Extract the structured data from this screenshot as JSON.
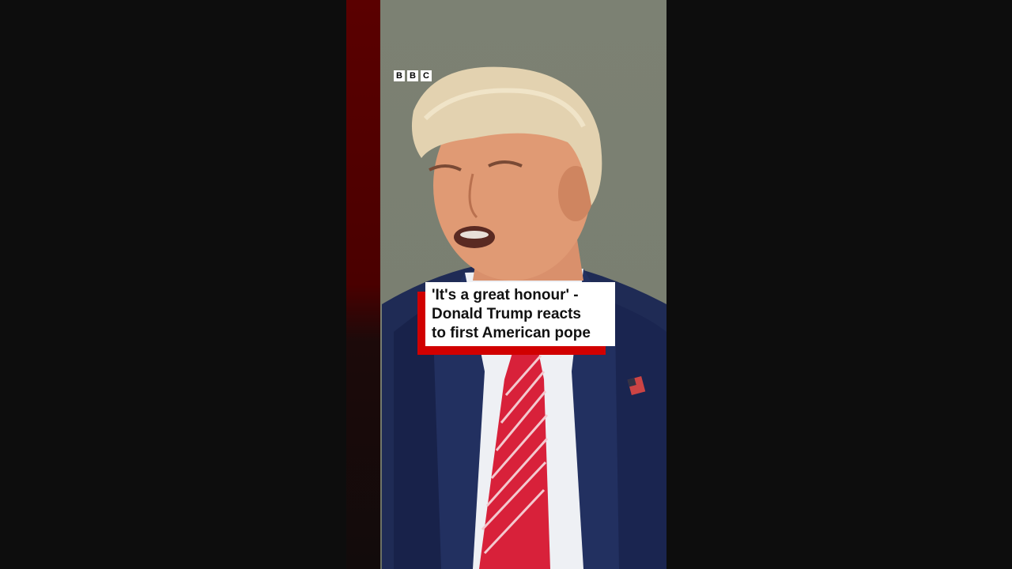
{
  "player": {
    "brand": {
      "letters": [
        "B",
        "B",
        "C"
      ]
    },
    "caption": {
      "line1": "'It's a great honour' -",
      "line2": "Donald Trump reacts",
      "line3": "to first American pope"
    },
    "colors": {
      "caption_accent": "#d10000",
      "caption_background": "#ffffff",
      "letterbox": "#0d0d0d"
    }
  }
}
